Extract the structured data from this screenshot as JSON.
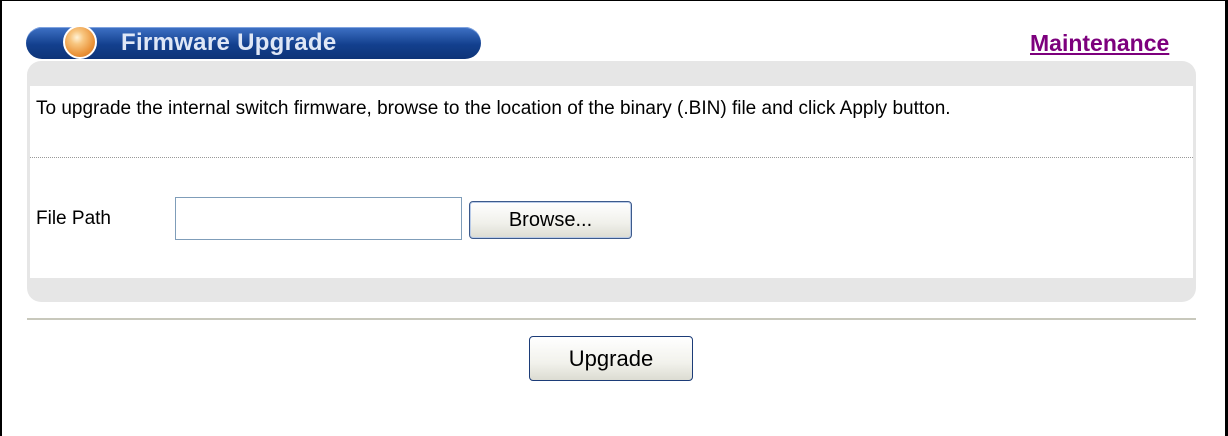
{
  "header": {
    "title": "Firmware Upgrade",
    "link": "Maintenance"
  },
  "panel": {
    "description": "To upgrade the internal switch firmware, browse to the location of the binary (.BIN) file and click Apply button.",
    "file_path_label": "File Path",
    "file_path_value": "",
    "browse_label": "Browse..."
  },
  "footer": {
    "upgrade_label": "Upgrade"
  },
  "colors": {
    "title_bar": "#13408e",
    "link": "#7d007d",
    "panel_bg": "#e6e6e6"
  }
}
